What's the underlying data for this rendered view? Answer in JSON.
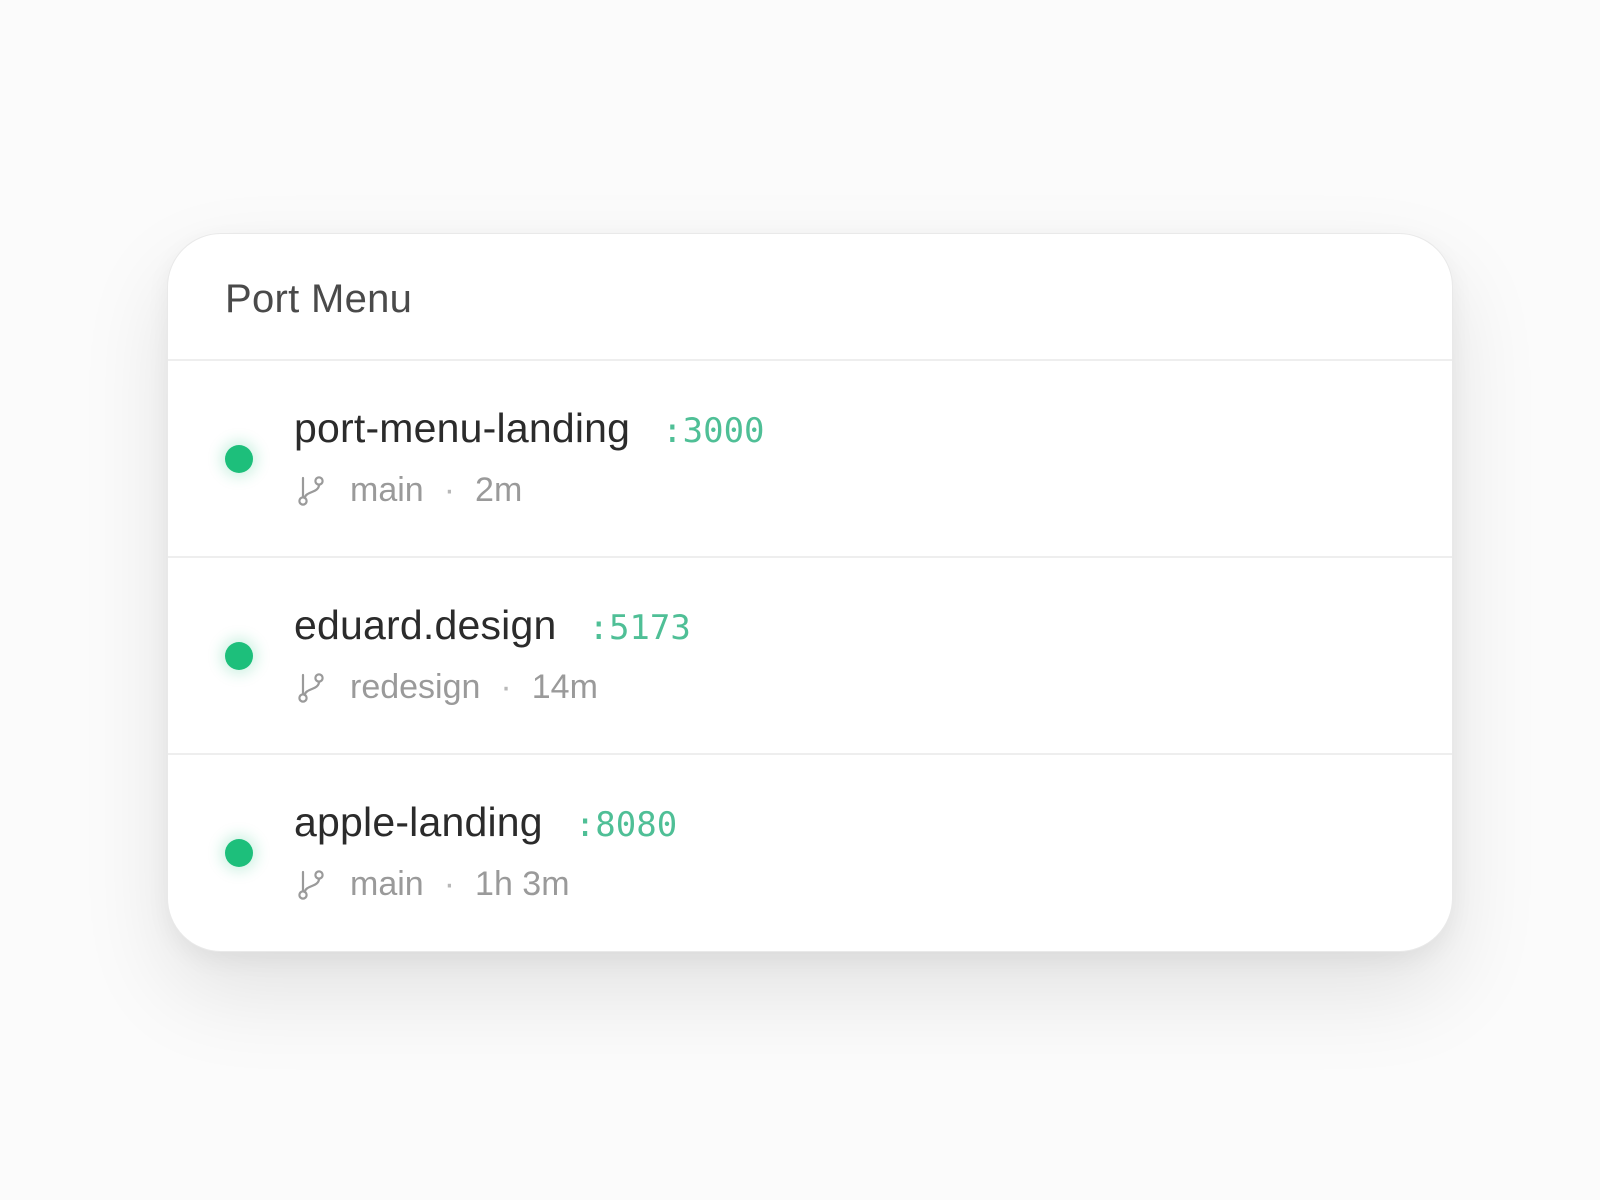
{
  "window": {
    "title": "Port Menu"
  },
  "colors": {
    "status_running": "#1dbf7b",
    "port_text": "#4fbf96"
  },
  "rows": [
    {
      "name": "port-menu-landing",
      "port": ":3000",
      "branch": "main",
      "separator": "·",
      "uptime": "2m",
      "status": "running",
      "branch_icon": "git-branch-icon"
    },
    {
      "name": "eduard.design",
      "port": ":5173",
      "branch": "redesign",
      "separator": "·",
      "uptime": "14m",
      "status": "running",
      "branch_icon": "git-branch-icon"
    },
    {
      "name": "apple-landing",
      "port": ":8080",
      "branch": "main",
      "separator": "·",
      "uptime": "1h 3m",
      "status": "running",
      "branch_icon": "git-branch-icon"
    }
  ]
}
